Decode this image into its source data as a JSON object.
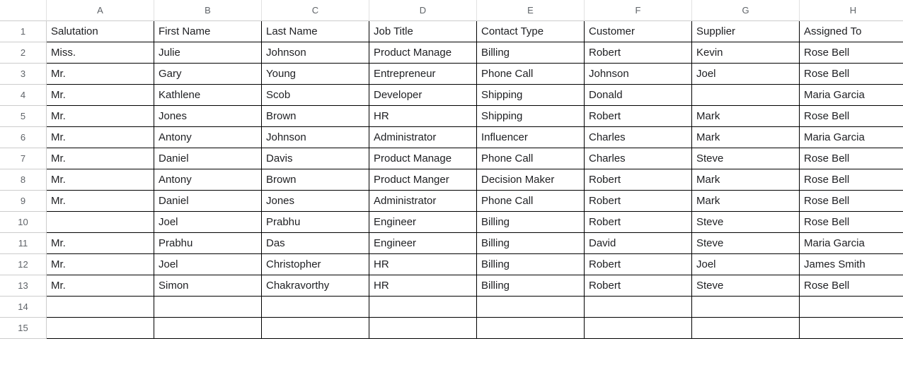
{
  "columns": [
    "A",
    "B",
    "C",
    "D",
    "E",
    "F",
    "G",
    "H"
  ],
  "rowNumbers": [
    "1",
    "2",
    "3",
    "4",
    "5",
    "6",
    "7",
    "8",
    "9",
    "10",
    "11",
    "12",
    "13",
    "14",
    "15"
  ],
  "headers": [
    "Salutation",
    "First Name",
    "Last Name",
    "Job Title",
    "Contact Type",
    "Customer",
    "Supplier",
    "Assigned To"
  ],
  "rows": [
    [
      "Miss.",
      "Julie",
      "Johnson",
      "Product Manage",
      "Billing",
      "Robert",
      "Kevin",
      "Rose Bell"
    ],
    [
      "Mr.",
      "Gary",
      "Young",
      "Entrepreneur",
      "Phone Call",
      "Johnson",
      "Joel",
      "Rose Bell"
    ],
    [
      "Mr.",
      "Kathlene",
      "Scob",
      "Developer",
      "Shipping",
      "Donald",
      "",
      "Maria Garcia"
    ],
    [
      "Mr.",
      "Jones",
      "Brown",
      "HR",
      "Shipping",
      "Robert",
      "Mark",
      "Rose Bell"
    ],
    [
      "Mr.",
      "Antony",
      "Johnson",
      "Administrator",
      "Influencer",
      "Charles",
      "Mark",
      "Maria Garcia"
    ],
    [
      "Mr.",
      "Daniel",
      "Davis",
      "Product Manage",
      "Phone Call",
      "Charles",
      "Steve",
      "Rose Bell"
    ],
    [
      "Mr.",
      "Antony",
      "Brown",
      "Product Manger",
      "Decision Maker",
      "Robert",
      "Mark",
      "Rose Bell"
    ],
    [
      "Mr.",
      "Daniel",
      "Jones",
      "Administrator",
      "Phone Call",
      "Robert",
      "Mark",
      "Rose Bell"
    ],
    [
      "",
      "Joel",
      "Prabhu",
      "Engineer",
      "Billing",
      "Robert",
      "Steve",
      "Rose Bell"
    ],
    [
      "Mr.",
      "Prabhu",
      "Das",
      "Engineer",
      "Billing",
      "David",
      "Steve",
      "Maria Garcia"
    ],
    [
      "Mr.",
      "Joel",
      "Christopher",
      "HR",
      "Billing",
      "Robert",
      "Joel",
      "James Smith"
    ],
    [
      "Mr.",
      "Simon",
      "Chakravorthy",
      "HR",
      "Billing",
      "Robert",
      "Steve",
      "Rose Bell"
    ]
  ],
  "emptyRows": 2
}
